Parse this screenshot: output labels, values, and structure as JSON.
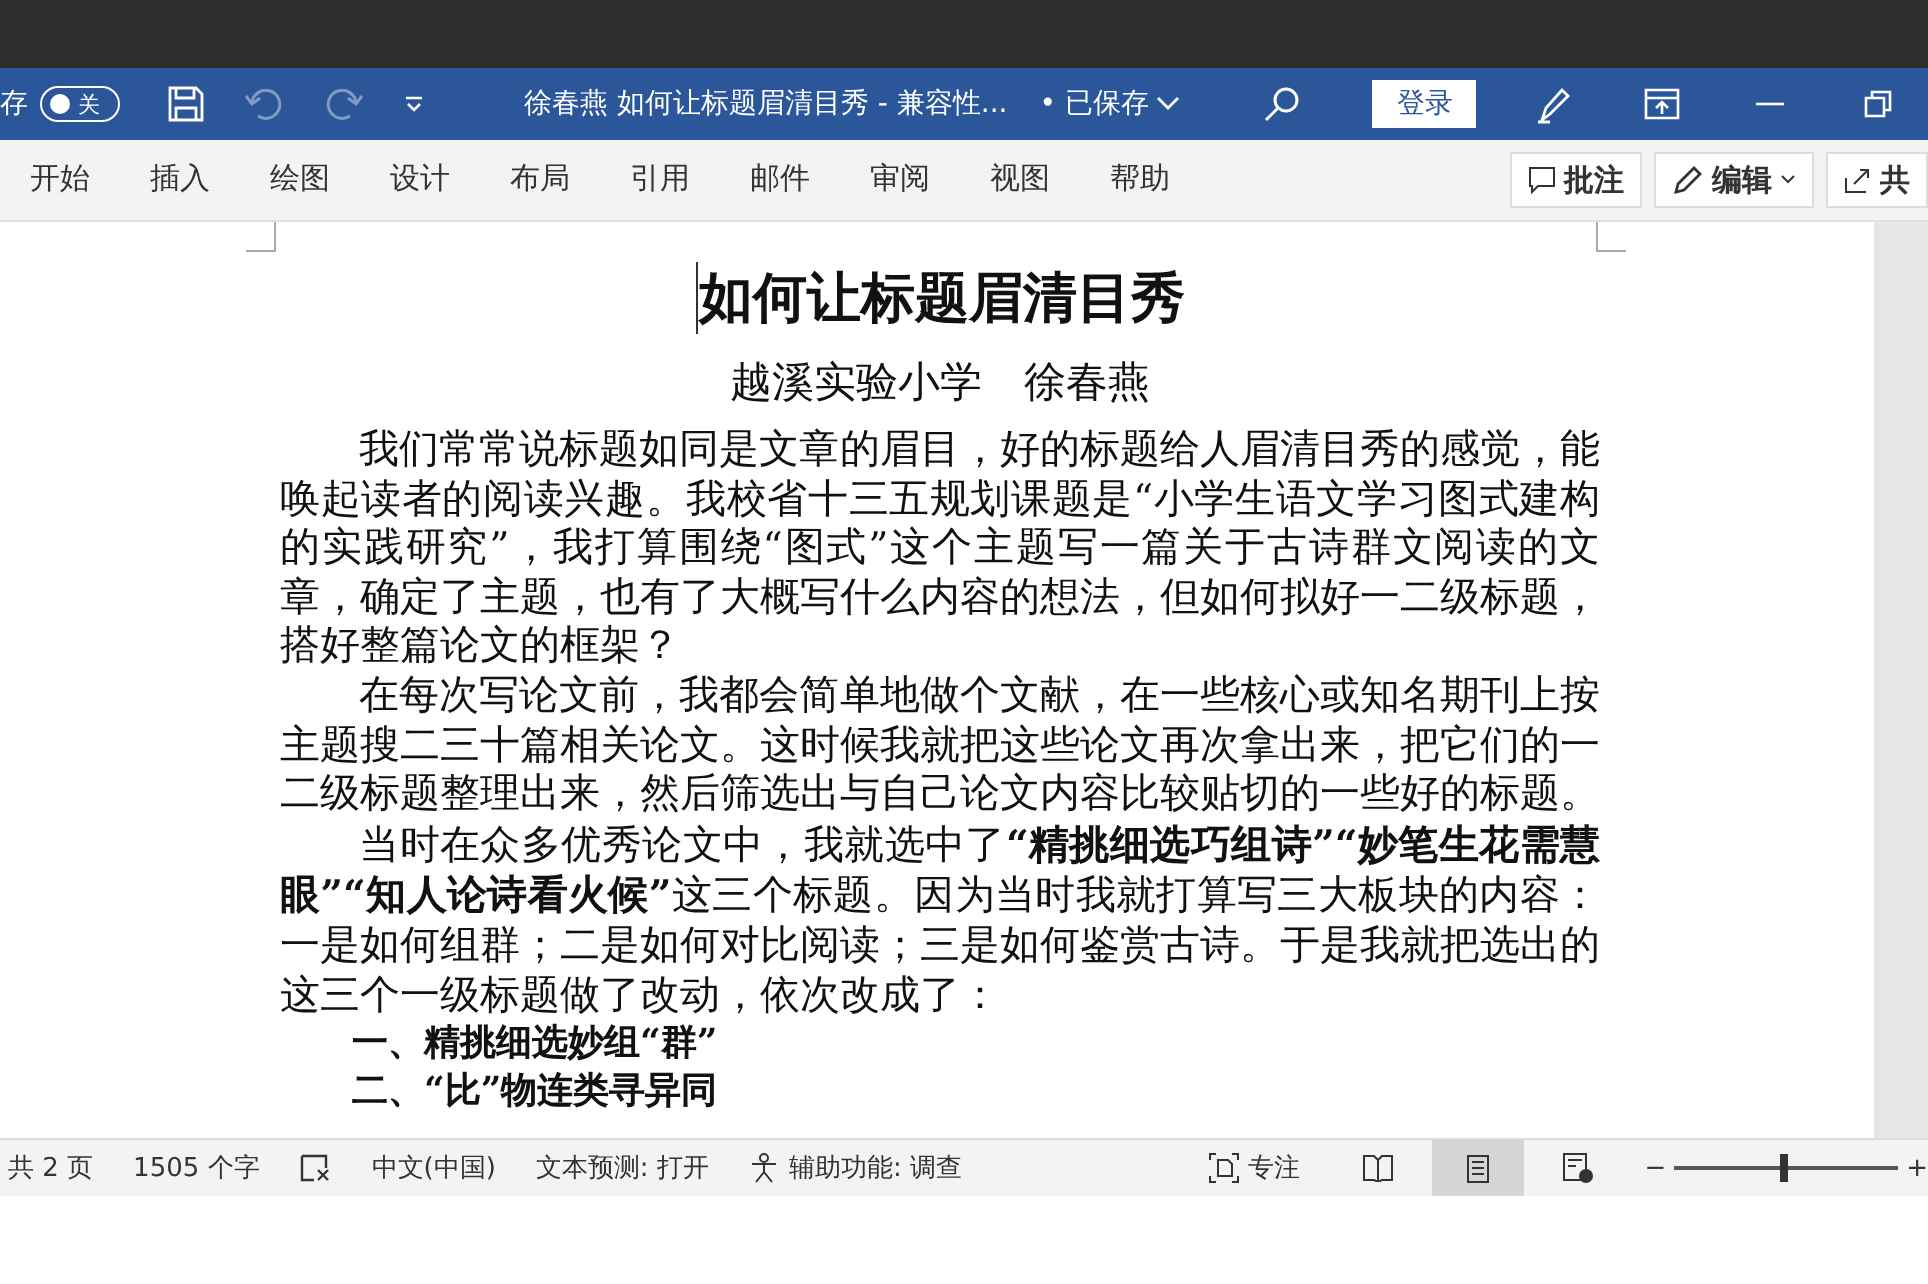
{
  "title_bar": {
    "autosave_label": "存",
    "autosave_toggle": {
      "label": "关",
      "on": false
    },
    "undo_disabled": true,
    "redo_disabled": true,
    "title": "徐春燕 如何让标题眉清目秀  -  兼容性...",
    "save_state": "• 已保存",
    "login": "登录"
  },
  "ribbon_tabs": [
    {
      "label": "开始",
      "selected": false
    },
    {
      "label": "插入",
      "selected": false
    },
    {
      "label": "绘图",
      "selected": false
    },
    {
      "label": "设计",
      "selected": false
    },
    {
      "label": "布局",
      "selected": false
    },
    {
      "label": "引用",
      "selected": false
    },
    {
      "label": "邮件",
      "selected": false
    },
    {
      "label": "审阅",
      "selected": false
    },
    {
      "label": "视图",
      "selected": false
    },
    {
      "label": "帮助",
      "selected": false
    }
  ],
  "ribbon_buttons": [
    {
      "kind": "comment",
      "label": "批注"
    },
    {
      "kind": "edit",
      "label": "编辑"
    },
    {
      "kind": "share",
      "label": "共"
    }
  ],
  "document": {
    "title": "如何让标题眉清目秀",
    "subtitle": "越溪实验小学　徐春燕",
    "paragraphs": [
      {
        "kind": "body",
        "text": "我们常常说标题如同是文章的眉目，好的标题给人眉清目秀的感觉，能唤起读者的阅读兴趣。我校省十三五规划课题是“小学生语文学习图式建构的实践研究”，我打算围绕“图式”这个主题写一篇关于古诗群文阅读的文章，确定了主题，也有了大概写什么内容的想法，但如何拟好一二级标题，搭好整篇论文的框架？"
      },
      {
        "kind": "body",
        "text": "在每次写论文前，我都会简单地做个文献，在一些核心或知名期刊上按主题搜二三十篇相关论文。这时候我就把这些论文再次拿出来，把它们的一二级标题整理出来，然后筛选出与自己论文内容比较贴切的一些好的标题。"
      },
      {
        "kind": "body",
        "text": "当时在众多优秀论文中，我就选中了**“精挑细选巧组诗”“妙笔生花需慧眼”“知人论诗看火候”**这三个标题。因为当时我就打算写三大板块的内容：一是如何组群；二是如何对比阅读；三是如何鉴赏古诗。于是我就把选出的这三个一级标题做了改动，依次改成了："
      },
      {
        "kind": "heading",
        "text": "一、精挑细选妙组“群”"
      },
      {
        "kind": "heading",
        "text": "二、“比”物连类寻异同"
      }
    ]
  },
  "status_bar": {
    "pages": "共 2 页",
    "words": "1505 个字",
    "language": "中文(中国)",
    "prediction": "文本预测: 打开",
    "accessibility": "辅助功能: 调查",
    "focus": "专注",
    "views": [
      {
        "kind": "read",
        "selected": false
      },
      {
        "kind": "print",
        "selected": true
      },
      {
        "kind": "web",
        "selected": false
      }
    ],
    "zoom": {
      "minus": "−",
      "plus": "+",
      "level": 0.49
    }
  }
}
